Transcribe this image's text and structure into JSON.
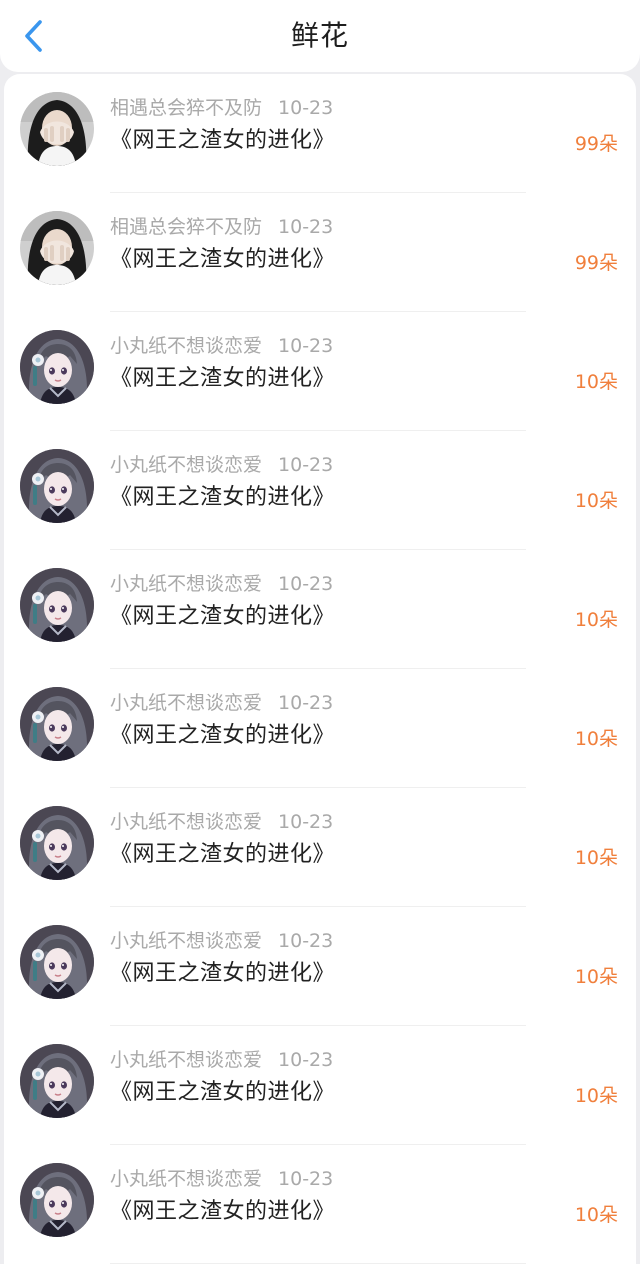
{
  "header": {
    "title": "鲜花",
    "back_icon": "chevron-left-icon",
    "back_color": "#3a96ee"
  },
  "colors": {
    "amount": "#f07f3c",
    "meta": "#a9a9a9",
    "book": "#222222"
  },
  "items": [
    {
      "user": "相遇总会猝不及防",
      "date": "10-23",
      "book": "《网王之渣女的进化》",
      "amount": "99朵",
      "avatar": "avatar-girl-covering-face"
    },
    {
      "user": "相遇总会猝不及防",
      "date": "10-23",
      "book": "《网王之渣女的进化》",
      "amount": "99朵",
      "avatar": "avatar-girl-covering-face"
    },
    {
      "user": "小丸纸不想谈恋爱",
      "date": "10-23",
      "book": "《网王之渣女的进化》",
      "amount": "10朵",
      "avatar": "avatar-anime-girl"
    },
    {
      "user": "小丸纸不想谈恋爱",
      "date": "10-23",
      "book": "《网王之渣女的进化》",
      "amount": "10朵",
      "avatar": "avatar-anime-girl"
    },
    {
      "user": "小丸纸不想谈恋爱",
      "date": "10-23",
      "book": "《网王之渣女的进化》",
      "amount": "10朵",
      "avatar": "avatar-anime-girl"
    },
    {
      "user": "小丸纸不想谈恋爱",
      "date": "10-23",
      "book": "《网王之渣女的进化》",
      "amount": "10朵",
      "avatar": "avatar-anime-girl"
    },
    {
      "user": "小丸纸不想谈恋爱",
      "date": "10-23",
      "book": "《网王之渣女的进化》",
      "amount": "10朵",
      "avatar": "avatar-anime-girl"
    },
    {
      "user": "小丸纸不想谈恋爱",
      "date": "10-23",
      "book": "《网王之渣女的进化》",
      "amount": "10朵",
      "avatar": "avatar-anime-girl"
    },
    {
      "user": "小丸纸不想谈恋爱",
      "date": "10-23",
      "book": "《网王之渣女的进化》",
      "amount": "10朵",
      "avatar": "avatar-anime-girl"
    },
    {
      "user": "小丸纸不想谈恋爱",
      "date": "10-23",
      "book": "《网王之渣女的进化》",
      "amount": "10朵",
      "avatar": "avatar-anime-girl"
    }
  ]
}
